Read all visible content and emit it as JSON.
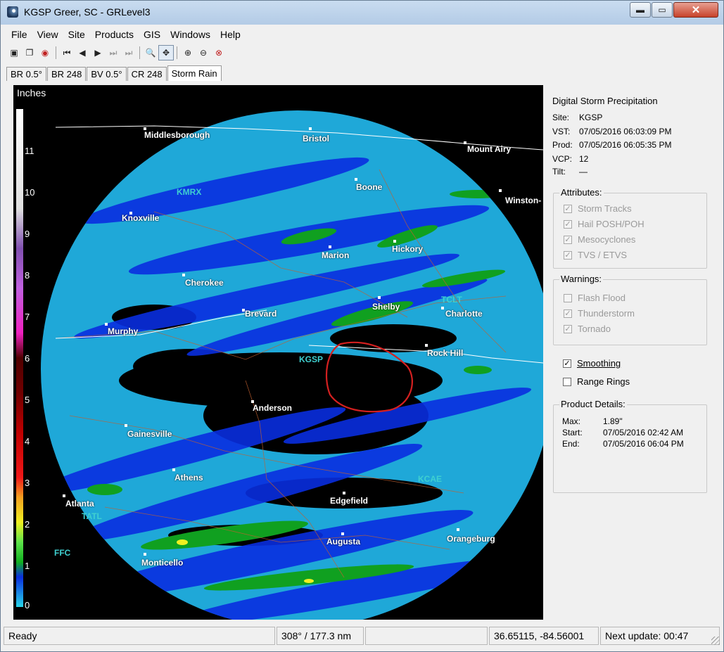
{
  "window": {
    "title": "KGSP Greer, SC - GRLevel3",
    "min_glyph": "▬",
    "max_glyph": "▭",
    "close_glyph": "✕"
  },
  "menu": [
    "File",
    "View",
    "Site",
    "Products",
    "GIS",
    "Windows",
    "Help"
  ],
  "toolbar": {
    "icons": [
      "copy-image-icon",
      "copy-icon",
      "record-icon",
      "first-frame-icon",
      "prev-frame-icon",
      "play-icon",
      "next-frame-icon",
      "last-frame-icon",
      "zoom-icon",
      "pan-icon",
      "zoom-in-icon",
      "zoom-out-icon",
      "zoom-reset-icon"
    ],
    "glyphs": [
      "▣",
      "❐",
      "◉",
      "⏮",
      "◀",
      "▶",
      "⏭",
      "⏭",
      "🔍",
      "✥",
      "⊕",
      "⊖",
      "⊗"
    ]
  },
  "tabs": [
    "BR 0.5°",
    "BR 248",
    "BV 0.5°",
    "CR 248",
    "Storm Rain"
  ],
  "legend": {
    "title": "Inches",
    "ticks": [
      "11",
      "10",
      "9",
      "8",
      "7",
      "6",
      "5",
      "4",
      "3",
      "2",
      "1",
      "0"
    ]
  },
  "map": {
    "cities": [
      "Middlesborough",
      "Bristol",
      "Mount Airy",
      "Boone",
      "Winston-",
      "Knoxville",
      "Marion",
      "Hickory",
      "Cherokee",
      "Brevard",
      "Shelby",
      "Charlotte",
      "Murphy",
      "Rock Hill",
      "Anderson",
      "Gainesville",
      "Athens",
      "Edgefield",
      "Atlanta",
      "Augusta",
      "Orangeburg",
      "Monticello"
    ],
    "sites": [
      "KMRX",
      "TCLT",
      "KGSP",
      "KCAE",
      "TATL",
      "FFC"
    ]
  },
  "panel": {
    "title": "Digital Storm Precipitation",
    "site_label": "Site:",
    "site": "KGSP",
    "vst_label": "VST:",
    "vst": "07/05/2016  06:03:09 PM",
    "prod_label": "Prod:",
    "prod": "07/05/2016  06:05:35 PM",
    "vcp_label": "VCP:",
    "vcp": "12",
    "tilt_label": "Tilt:",
    "tilt": "—",
    "attributes_title": "Attributes:",
    "attributes": [
      "Storm Tracks",
      "Hail POSH/POH",
      "Mesocyclones",
      "TVS / ETVS"
    ],
    "warnings_title": "Warnings:",
    "warnings": [
      {
        "label": "Flash Flood",
        "checked": false
      },
      {
        "label": "Thunderstorm",
        "checked": true
      },
      {
        "label": "Tornado",
        "checked": true
      }
    ],
    "smoothing": "Smoothing",
    "smoothing_checked": true,
    "range_rings": "Range Rings",
    "range_rings_checked": false,
    "details_title": "Product Details:",
    "max_label": "Max:",
    "max": "1.89\"",
    "start_label": "Start:",
    "start": "07/05/2016  02:42 AM",
    "end_label": "End:",
    "end": "07/05/2016  06:04 PM"
  },
  "status": {
    "ready": "Ready",
    "bearing": "308° / 177.3 nm",
    "coords": "36.65115, -84.56001",
    "next_update": "Next update: 00:47"
  },
  "colors": {
    "accent": "#3fd0d0",
    "annotation": "#d42020"
  }
}
